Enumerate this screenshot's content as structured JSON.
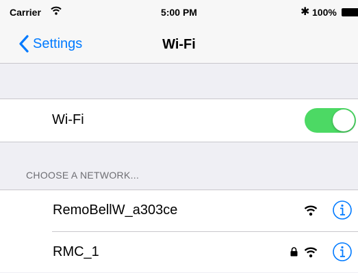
{
  "status_bar": {
    "carrier": "Carrier",
    "time": "5:00 PM",
    "bluetooth": "✱",
    "battery": "100%"
  },
  "nav": {
    "back_label": "Settings",
    "title": "Wi-Fi"
  },
  "wifi_toggle": {
    "label": "Wi-Fi",
    "on": true,
    "on_color": "#4cd964"
  },
  "networks_section": {
    "header": "CHOOSE A NETWORK...",
    "items": [
      {
        "name": "RemoBellW_a303ce",
        "locked": false
      },
      {
        "name": "RMC_1",
        "locked": true
      }
    ]
  },
  "colors": {
    "accent": "#007aff",
    "background": "#efeff4"
  }
}
